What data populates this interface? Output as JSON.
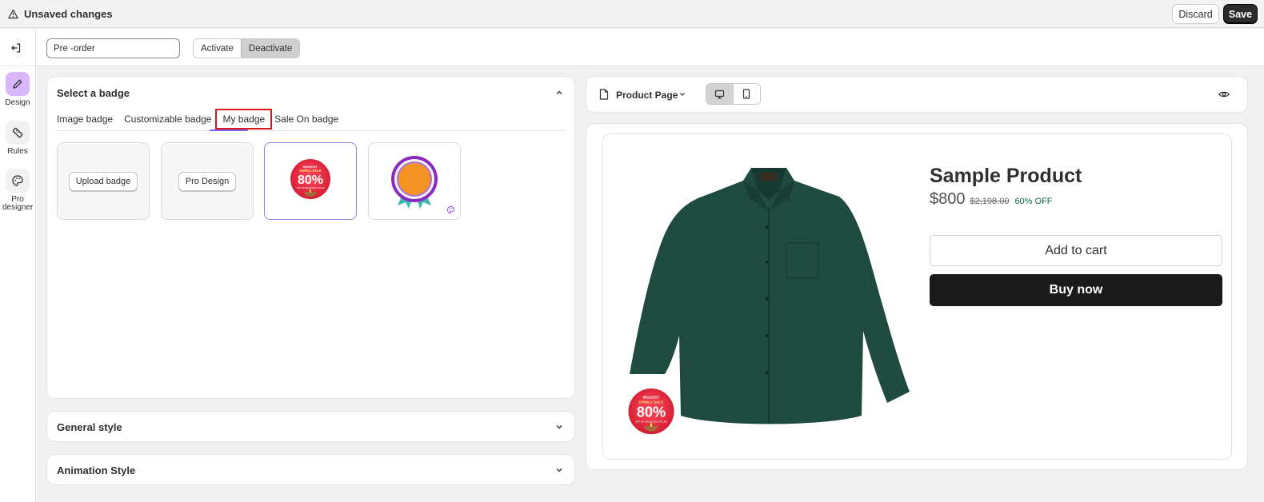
{
  "topbar": {
    "status_label": "Unsaved changes",
    "discard_label": "Discard",
    "save_label": "Save"
  },
  "rail": {
    "items": [
      {
        "label": "Design",
        "icon": "pencil-icon",
        "active": true
      },
      {
        "label": "Rules",
        "icon": "ruler-icon",
        "active": false
      },
      {
        "label": "Pro designer",
        "icon": "palette-icon",
        "active": false
      }
    ]
  },
  "header": {
    "badge_name_value": "Pre -order",
    "activate_label": "Activate",
    "deactivate_label": "Deactivate"
  },
  "select_badge": {
    "title": "Select a badge",
    "tabs": [
      {
        "label": "Image badge"
      },
      {
        "label": "Customizable badge"
      },
      {
        "label": "My badge",
        "selected": true
      },
      {
        "label": "Sale On badge"
      }
    ],
    "tiles": [
      {
        "label": "Upload badge"
      },
      {
        "label": "Pro Design"
      }
    ],
    "badge_text": {
      "line1": "BIGGEST",
      "line2": "DIWALI SALE",
      "percent": "80%",
      "line3": "OFF ON SELECTED STYLES"
    }
  },
  "general_style": {
    "title": "General style"
  },
  "animation_style": {
    "title": "Animation Style"
  },
  "preview": {
    "page_label": "Product Page",
    "product_title": "Sample Product",
    "price": "$800",
    "compare_price": "$2,198.00",
    "discount": "60% OFF",
    "add_to_cart_label": "Add to cart",
    "buy_now_label": "Buy now",
    "colors": {
      "shirt": "#1f4a40",
      "badge_red": "#e8283a",
      "accent": "#7b61ff"
    }
  }
}
